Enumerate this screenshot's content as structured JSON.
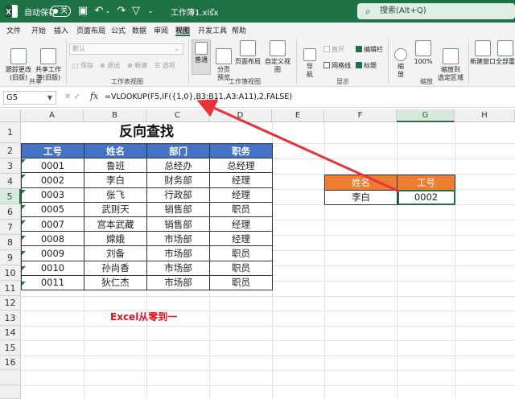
{
  "titlebar": {
    "autosave_label": "自动保存",
    "autosave_state": "关",
    "filename": "工作簿1.xlsx",
    "filename_caret": "⌄",
    "search_placeholder": "搜索(Alt+Q)"
  },
  "tabs": [
    "文件",
    "开始",
    "插入",
    "页面布局",
    "公式",
    "数据",
    "审阅",
    "视图",
    "开发工具",
    "帮助"
  ],
  "active_tab": "视图",
  "ribbon": {
    "share": {
      "btn1": "跟踪更改\n(旧版)",
      "btn2": "共享工作\n簿(旧版)",
      "group": "共享"
    },
    "sheet_view": {
      "dropdown": "默认",
      "keep": "保存",
      "exit": "退出",
      "new": "新建",
      "options": "选项",
      "group": "工作表视图"
    },
    "workbook_views": {
      "normal": "普通",
      "page_break": "分页\n预览",
      "page_layout": "页面布局",
      "custom": "自定义视图",
      "group": "工作簿视图"
    },
    "show": {
      "nav": "导\n航",
      "ruler": "直尺",
      "gridlines": "网格线",
      "formula_bar": "编辑栏",
      "headings": "标题",
      "group": "显示"
    },
    "zoom": {
      "zoom": "缩\n放",
      "zoom100": "100%",
      "zoom_sel": "缩放到\n选定区域",
      "group": "缩放"
    },
    "window": {
      "new_window": "新建窗口",
      "arrange_all": "全部重"
    }
  },
  "formula_bar": {
    "name_box": "G5",
    "cancel": "✕",
    "enter": "✓",
    "fx": "fx",
    "formula": "=VLOOKUP(F5,IF({1,0},B3:B11,A3:A11),2,FALSE)"
  },
  "columns": [
    "A",
    "B",
    "C",
    "D",
    "E",
    "F",
    "G",
    "H"
  ],
  "rows": [
    "1",
    "2",
    "3",
    "4",
    "5",
    "6",
    "7",
    "8",
    "9",
    "10",
    "11",
    "12",
    "13",
    "14",
    "15",
    "16"
  ],
  "sheet": {
    "title": "反向查找",
    "table_headers": [
      "工号",
      "姓名",
      "部门",
      "职务"
    ],
    "table_rows": [
      [
        "0001",
        "鲁班",
        "总经办",
        "总经理"
      ],
      [
        "0002",
        "李白",
        "财务部",
        "经理"
      ],
      [
        "0003",
        "张飞",
        "行政部",
        "经理"
      ],
      [
        "0005",
        "武则天",
        "销售部",
        "职员"
      ],
      [
        "0007",
        "宫本武藏",
        "销售部",
        "经理"
      ],
      [
        "0008",
        "嫦娥",
        "市场部",
        "经理"
      ],
      [
        "0009",
        "刘备",
        "市场部",
        "职员"
      ],
      [
        "0010",
        "孙尚香",
        "市场部",
        "职员"
      ],
      [
        "0011",
        "狄仁杰",
        "市场部",
        "职员"
      ]
    ],
    "lookup_headers": [
      "姓名",
      "工号"
    ],
    "lookup_values": [
      "李白",
      "0002"
    ],
    "watermark": "Excel从零到一"
  },
  "colors": {
    "titlebar": "#1f7245",
    "header_blue": "#4472c4",
    "header_orange": "#ed7d31",
    "label_red": "#e8101a",
    "arrow_red": "#e8333a"
  }
}
